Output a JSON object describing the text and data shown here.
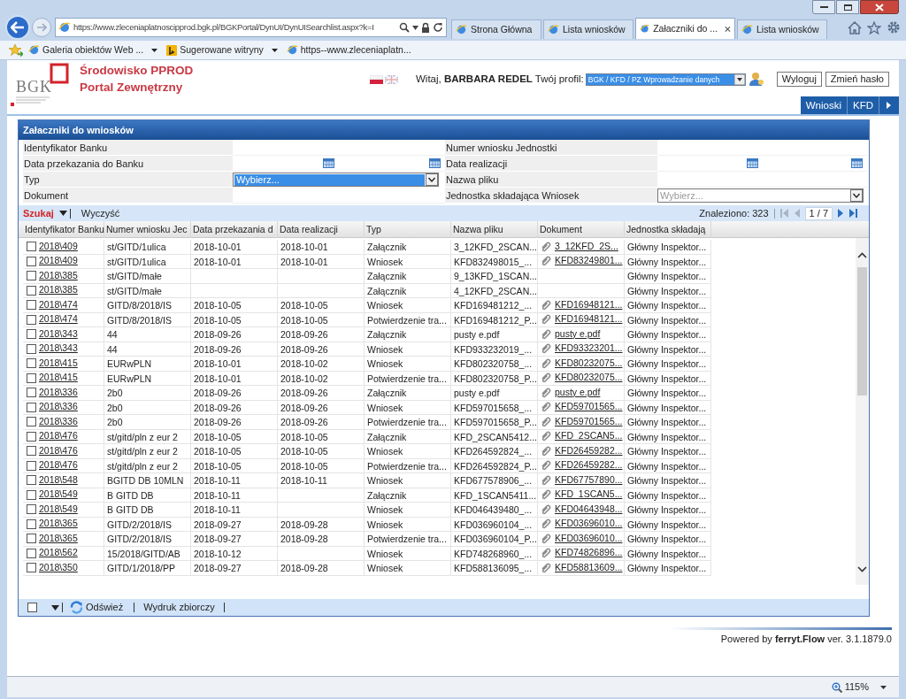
{
  "browser": {
    "address": "https://www.zleceniaplatnoscipprod.bgk.pl/BGKPortal/DynUI/DynUISearchlist.aspx?k=I",
    "tabs": [
      {
        "label": "Strona Główna",
        "selected": false
      },
      {
        "label": "Lista wniosków",
        "selected": false
      },
      {
        "label": "Załaczniki do ...",
        "selected": true
      },
      {
        "label": "Lista wniosków",
        "selected": false
      }
    ],
    "favorites": [
      {
        "label": "Galeria obiektów Web ...",
        "kind": "page",
        "has_menu": true
      },
      {
        "label": "Sugerowane witryny",
        "kind": "suggested",
        "has_menu": true
      },
      {
        "label": "https--www.zleceniaplatn...",
        "kind": "page",
        "has_menu": false
      }
    ]
  },
  "header": {
    "logo_text": "BGK",
    "title_lines": [
      "Środowisko PPROD",
      "Portal Zewnętrzny"
    ],
    "welcome": "Witaj, **BARBARA REDEL** Twój profil:",
    "profile": "BGK / KFD / PZ Wprowadzanie danych",
    "buttons": [
      "Wyloguj",
      "Zmień hasło"
    ]
  },
  "nav_tabs": [
    "Wnioski",
    "KFD"
  ],
  "panel": {
    "title": "Załaczniki do wniosków",
    "filters": [
      {
        "label": "Identyfikator Banku",
        "kind": "text"
      },
      {
        "label": "Numer wniosku Jednostki",
        "kind": "text"
      },
      {
        "label": "Data przekazania do Banku",
        "kind": "daterange"
      },
      {
        "label": "Data realizacji",
        "kind": "daterange"
      },
      {
        "label": "Typ",
        "kind": "select",
        "value": "Wybierz...",
        "focused": true
      },
      {
        "label": "Nazwa pliku",
        "kind": "text"
      },
      {
        "label": "Dokument",
        "kind": "text"
      },
      {
        "label": "Jednostka składająca Wniosek",
        "kind": "select",
        "value": "Wybierz...",
        "focused": false
      }
    ],
    "toolbar": {
      "search": "Szukaj",
      "clear": "Wyczyść",
      "found": "Znaleziono: 323",
      "page": "1 / 7",
      "prev_enabled": false,
      "next_enabled": true
    }
  },
  "table": {
    "columns": [
      "Identyfikator Banku",
      "Numer wniosku Jec",
      "Data przekazania d",
      "Data realizacji",
      "Typ",
      "Nazwa pliku",
      "Dokument",
      "Jednostka składają"
    ],
    "rows": [
      {
        "checked": false,
        "id": "2018\\409",
        "number": "st/GITD/1ulica",
        "sent": "2018-10-01",
        "done": "2018-10-01",
        "type": "Załącznik",
        "file": "3_12KFD_2SCAN...",
        "document": "3_12KFD_2S...",
        "unit": "Główny Inspektor..."
      },
      {
        "checked": false,
        "id": "2018\\409",
        "number": "st/GITD/1ulica",
        "sent": "2018-10-01",
        "done": "2018-10-01",
        "type": "Wniosek",
        "file": "KFD832498015_...",
        "document": "KFD83249801...",
        "unit": "Główny Inspektor..."
      },
      {
        "checked": false,
        "id": "2018\\385",
        "number": "st/GITD/małe",
        "type": "Załącznik",
        "file": "9_13KFD_1SCAN...",
        "unit": "Główny Inspektor..."
      },
      {
        "checked": false,
        "id": "2018\\385",
        "number": "st/GITD/małe",
        "type": "Załącznik",
        "file": "4_12KFD_2SCAN...",
        "unit": "Główny Inspektor..."
      },
      {
        "checked": false,
        "id": "2018\\474",
        "number": "GITD/8/2018/IS",
        "sent": "2018-10-05",
        "done": "2018-10-05",
        "type": "Wniosek",
        "file": "KFD169481212_...",
        "document": "KFD16948121...",
        "unit": "Główny Inspektor..."
      },
      {
        "checked": false,
        "id": "2018\\474",
        "number": "GITD/8/2018/IS",
        "sent": "2018-10-05",
        "done": "2018-10-05",
        "type": "Potwierdzenie tra...",
        "file": "KFD169481212_P...",
        "document": "KFD16948121...",
        "unit": "Główny Inspektor..."
      },
      {
        "checked": false,
        "id": "2018\\343",
        "number": "44",
        "sent": "2018-09-26",
        "done": "2018-09-26",
        "type": "Załącznik",
        "file": "pusty e.pdf",
        "document": "pusty e.pdf",
        "unit": "Główny Inspektor..."
      },
      {
        "checked": false,
        "id": "2018\\343",
        "number": "44",
        "sent": "2018-09-26",
        "done": "2018-09-26",
        "type": "Wniosek",
        "file": "KFD933232019_...",
        "document": "KFD93323201...",
        "unit": "Główny Inspektor..."
      },
      {
        "checked": false,
        "id": "2018\\415",
        "number": "EURwPLN",
        "sent": "2018-10-01",
        "done": "2018-10-02",
        "type": "Wniosek",
        "file": "KFD802320758_...",
        "document": "KFD80232075...",
        "unit": "Główny Inspektor..."
      },
      {
        "checked": false,
        "id": "2018\\415",
        "number": "EURwPLN",
        "sent": "2018-10-01",
        "done": "2018-10-02",
        "type": "Potwierdzenie tra...",
        "file": "KFD802320758_P...",
        "document": "KFD80232075...",
        "unit": "Główny Inspektor..."
      },
      {
        "checked": false,
        "id": "2018\\336",
        "number": "2b0",
        "sent": "2018-09-26",
        "done": "2018-09-26",
        "type": "Załącznik",
        "file": "pusty e.pdf",
        "document": "pusty e.pdf",
        "unit": "Główny Inspektor..."
      },
      {
        "checked": false,
        "id": "2018\\336",
        "number": "2b0",
        "sent": "2018-09-26",
        "done": "2018-09-26",
        "type": "Wniosek",
        "file": "KFD597015658_...",
        "document": "KFD59701565...",
        "unit": "Główny Inspektor..."
      },
      {
        "checked": false,
        "id": "2018\\336",
        "number": "2b0",
        "sent": "2018-09-26",
        "done": "2018-09-26",
        "type": "Potwierdzenie tra...",
        "file": "KFD597015658_P...",
        "document": "KFD59701565...",
        "unit": "Główny Inspektor..."
      },
      {
        "checked": false,
        "id": "2018\\476",
        "number": "st/gitd/pln z eur 2",
        "sent": "2018-10-05",
        "done": "2018-10-05",
        "type": "Załącznik",
        "file": "KFD_2SCAN5412...",
        "document": "KFD_2SCAN5...",
        "unit": "Główny Inspektor..."
      },
      {
        "checked": false,
        "id": "2018\\476",
        "number": "st/gitd/pln z eur 2",
        "sent": "2018-10-05",
        "done": "2018-10-05",
        "type": "Wniosek",
        "file": "KFD264592824_...",
        "document": "KFD26459282...",
        "unit": "Główny Inspektor..."
      },
      {
        "checked": false,
        "id": "2018\\476",
        "number": "st/gitd/pln z eur 2",
        "sent": "2018-10-05",
        "done": "2018-10-05",
        "type": "Potwierdzenie tra...",
        "file": "KFD264592824_P...",
        "document": "KFD26459282...",
        "unit": "Główny Inspektor..."
      },
      {
        "checked": false,
        "id": "2018\\548",
        "number": "BGITD DB 10MLN",
        "sent": "2018-10-11",
        "done": "2018-10-11",
        "type": "Wniosek",
        "file": "KFD677578906_...",
        "document": "KFD67757890...",
        "unit": "Główny Inspektor..."
      },
      {
        "checked": false,
        "id": "2018\\549",
        "number": "B GITD DB",
        "sent": "2018-10-11",
        "type": "Załącznik",
        "file": "KFD_1SCAN5411...",
        "document": "KFD_1SCAN5...",
        "unit": "Główny Inspektor..."
      },
      {
        "checked": false,
        "id": "2018\\549",
        "number": "B GITD DB",
        "sent": "2018-10-11",
        "type": "Wniosek",
        "file": "KFD046439480_...",
        "document": "KFD04643948...",
        "unit": "Główny Inspektor..."
      },
      {
        "checked": false,
        "id": "2018\\365",
        "number": "GITD/2/2018/IS",
        "sent": "2018-09-27",
        "done": "2018-09-28",
        "type": "Wniosek",
        "file": "KFD036960104_...",
        "document": "KFD03696010...",
        "unit": "Główny Inspektor..."
      },
      {
        "checked": false,
        "id": "2018\\365",
        "number": "GITD/2/2018/IS",
        "sent": "2018-09-27",
        "done": "2018-09-28",
        "type": "Potwierdzenie tra...",
        "file": "KFD036960104_P...",
        "document": "KFD03696010...",
        "unit": "Główny Inspektor..."
      },
      {
        "checked": false,
        "id": "2018\\562",
        "number": "15/2018/GITD/AB",
        "sent": "2018-10-12",
        "type": "Wniosek",
        "file": "KFD748268960_...",
        "document": "KFD74826896...",
        "unit": "Główny Inspektor..."
      },
      {
        "checked": false,
        "id": "2018\\350",
        "number": "GITD/1/2018/PP",
        "sent": "2018-09-27",
        "done": "2018-09-28",
        "type": "Wniosek",
        "file": "KFD588136095_...",
        "document": "KFD58813609...",
        "unit": "Główny Inspektor..."
      }
    ]
  },
  "footer_toolbar": {
    "select_all_checked": false,
    "refresh": "Odśwież",
    "print": "Wydruk zbiorczy"
  },
  "powered_by": "Powered by **ferryt.Flow** ver. 3.1.1879.0",
  "status_bar": {
    "zoom": "115%"
  }
}
